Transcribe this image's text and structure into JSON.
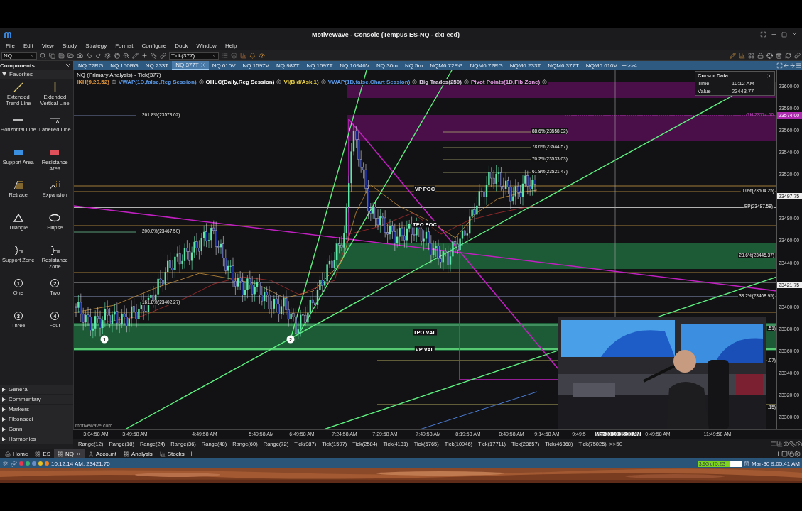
{
  "window": {
    "title": "MotiveWave - Console (Tempus ES-NQ - dxFeed)"
  },
  "menu": [
    "File",
    "Edit",
    "View",
    "Study",
    "Strategy",
    "Format",
    "Configure",
    "Dock",
    "Window",
    "Help"
  ],
  "toolbar": {
    "symbol": "NQ",
    "bar_size": "Tick(377)"
  },
  "components": {
    "title": "Components",
    "favorites": {
      "label": "Favorites",
      "expanded": true
    },
    "tools": [
      {
        "label": "Extended Trend Line",
        "kind": "trend"
      },
      {
        "label": "Extended Vertical Line",
        "kind": "vline"
      },
      {
        "label": "Horizontal Line",
        "kind": "hline"
      },
      {
        "label": "Labelled Line",
        "kind": "labelled"
      },
      {
        "label": "Support Area",
        "kind": "support"
      },
      {
        "label": "Resistance Area",
        "kind": "resistance"
      },
      {
        "label": "Retrace",
        "kind": "retrace"
      },
      {
        "label": "Expansion",
        "kind": "expansion"
      },
      {
        "label": "Triangle",
        "kind": "triangle"
      },
      {
        "label": "Ellipse",
        "kind": "ellipse"
      },
      {
        "label": "Support Zone",
        "kind": "zone"
      },
      {
        "label": "Resistance Zone",
        "kind": "zone"
      },
      {
        "label": "One",
        "kind": "number",
        "glyph": "1"
      },
      {
        "label": "Two",
        "kind": "number",
        "glyph": "2"
      },
      {
        "label": "Three",
        "kind": "number",
        "glyph": "3"
      },
      {
        "label": "Four",
        "kind": "number",
        "glyph": "4"
      }
    ],
    "categories": [
      {
        "label": "General",
        "expanded": false
      },
      {
        "label": "Commentary",
        "expanded": false
      },
      {
        "label": "Markers",
        "expanded": false
      },
      {
        "label": "Fibonacci",
        "expanded": false
      },
      {
        "label": "Gann",
        "expanded": false
      },
      {
        "label": "Harmonics",
        "expanded": false
      }
    ]
  },
  "chart_tabs": [
    {
      "label": "NQ 72RG",
      "selected": false
    },
    {
      "label": "NQ 150RG",
      "selected": false
    },
    {
      "label": "NQ 233T",
      "selected": false
    },
    {
      "label": "NQ 377T",
      "selected": true
    },
    {
      "label": "NQ 610V",
      "selected": false
    },
    {
      "label": "NQ 1597V",
      "selected": false
    },
    {
      "label": "NQ 987T",
      "selected": false
    },
    {
      "label": "NQ 1597T",
      "selected": false
    },
    {
      "label": "NQ 10946V",
      "selected": false
    },
    {
      "label": "NQ 30m",
      "selected": false
    },
    {
      "label": "NQ 5m",
      "selected": false
    },
    {
      "label": "NQM6 72RG",
      "selected": false
    },
    {
      "label": "NQM6 72RG",
      "selected": false
    },
    {
      "label": "NQM6 233T",
      "selected": false
    },
    {
      "label": "NQM6 377T",
      "selected": false
    },
    {
      "label": "NQM6 610V",
      "selected": false
    }
  ],
  "chart_tabs_overflow": ">>4",
  "chart": {
    "title": "NQ (Primary Analysis) - Tick(377)",
    "studies": [
      {
        "label": "IKH(9,26,52)",
        "color": "#e89a3c"
      },
      {
        "label": "VWAP(1D,false,Reg Session)",
        "color": "#5a9ae8"
      },
      {
        "label": "OHLC(Daily,Reg Session)",
        "color": "#ffffff"
      },
      {
        "label": "VI(Bid/Ask,1)",
        "color": "#e8d040"
      },
      {
        "label": "VWAP(1D,false,Chart Session)",
        "color": "#5a9ae8"
      },
      {
        "label": "Big Trades(250)",
        "color": "#e0d0e8"
      },
      {
        "label": "Pivot Points(1D,Fib Zone)",
        "color": "#e8a0e8"
      }
    ],
    "levels": [
      {
        "label": "261.8%(23573.02)"
      },
      {
        "label": "200.0%(23467.50)"
      },
      {
        "label": "161.8%(23402.27)"
      },
      {
        "label": "88.6%(23558.32)"
      },
      {
        "label": "78.6%(23544.57)"
      },
      {
        "label": "70.2%(23533.03)"
      },
      {
        "label": "61.8%(23521.47)"
      },
      {
        "label": "0.0%(23504.25)"
      },
      {
        "label": "BP(23487.58)"
      },
      {
        "label": "23.6%(23445.37)"
      },
      {
        "label": "38.2%(23408.95)"
      },
      {
        "label": ".51)"
      },
      {
        "label": ".07)"
      },
      {
        "label": ".15)"
      }
    ],
    "pivot_label": "GH:23574.00",
    "profile_labels": [
      "VP POC",
      "TPO POC",
      "TPO VAL",
      "VP VAL"
    ],
    "wave_markers": [
      "1",
      "2"
    ],
    "watermark_text": "motivewave.com",
    "cursor_data": {
      "title": "Cursor Data",
      "rows": [
        {
          "name": "Time",
          "value": "10:12 AM"
        },
        {
          "name": "Value",
          "value": "23443.77"
        }
      ]
    },
    "webcam": {
      "kind": "picture"
    },
    "price_axis": [
      {
        "label": "23600.00",
        "kind": "tick"
      },
      {
        "label": "23580.00",
        "kind": "tick"
      },
      {
        "label": "23560.00",
        "kind": "tick"
      },
      {
        "label": "23540.00",
        "kind": "tick"
      },
      {
        "label": "23520.00",
        "kind": "tick"
      },
      {
        "label": "23497.75",
        "kind": "current"
      },
      {
        "label": "23480.00",
        "kind": "tick"
      },
      {
        "label": "23460.00",
        "kind": "tick"
      },
      {
        "label": "23440.00",
        "kind": "tick"
      },
      {
        "label": "23421.75",
        "kind": "current"
      },
      {
        "label": "23400.00",
        "kind": "tick"
      },
      {
        "label": "23380.00",
        "kind": "tick"
      },
      {
        "label": "23360.00",
        "kind": "tick"
      },
      {
        "label": "23340.00",
        "kind": "tick"
      },
      {
        "label": "23320.00",
        "kind": "tick"
      },
      {
        "label": "23300.00",
        "kind": "tick"
      }
    ],
    "price_marker": "23574.00",
    "time_axis": [
      {
        "label": "3:04:58 AM",
        "kind": "tick"
      },
      {
        "label": "3:49:58 AM",
        "kind": "tick"
      },
      {
        "label": "4:49:58 AM",
        "kind": "tick"
      },
      {
        "label": "5:49:58 AM",
        "kind": "tick"
      },
      {
        "label": "6:49:58 AM",
        "kind": "tick"
      },
      {
        "label": "7:24:58 AM",
        "kind": "tick"
      },
      {
        "label": "7:29:58 AM",
        "kind": "tick"
      },
      {
        "label": "7:49:58 AM",
        "kind": "tick"
      },
      {
        "label": "8:19:58 AM",
        "kind": "tick"
      },
      {
        "label": "8:49:58 AM",
        "kind": "tick"
      },
      {
        "label": "9:14:58 AM",
        "kind": "tick"
      },
      {
        "label": "9:49:5",
        "kind": "tick"
      },
      {
        "label": "Mar-30 10:15:00 AM",
        "kind": "cursor"
      },
      {
        "label": "0:49:58 AM",
        "kind": "tick"
      },
      {
        "label": "11:49:58 AM",
        "kind": "tick"
      }
    ]
  },
  "bar_sizes": [
    "Range(12)",
    "Range(18)",
    "Range(24)",
    "Range(36)",
    "Range(48)",
    "Range(60)",
    "Range(72)",
    "Tick(987)",
    "Tick(1597)",
    "Tick(2584)",
    "Tick(4181)",
    "Tick(6765)",
    "Tick(10946)",
    "Tick(17711)",
    "Tick(28657)",
    "Tick(46368)",
    "Tick(75025)"
  ],
  "bar_sizes_overflow": ">>50",
  "workspace_tabs": [
    {
      "label": "Home",
      "kind": "home",
      "selected": false
    },
    {
      "label": "ES",
      "kind": "workspace",
      "selected": false
    },
    {
      "label": "NQ",
      "kind": "workspace",
      "selected": true
    },
    {
      "label": "Account",
      "kind": "account",
      "selected": false
    },
    {
      "label": "Analysis",
      "kind": "workspace",
      "selected": false
    },
    {
      "label": "Stocks",
      "kind": "chart",
      "selected": false
    }
  ],
  "status_bar": {
    "connections": [
      {
        "color": "#e8384f"
      },
      {
        "color": "#3cb371"
      },
      {
        "color": "#6a8fc8"
      },
      {
        "color": "#e8c020"
      },
      {
        "color": "#f08020"
      }
    ],
    "cursor": "10:12:14 AM, 23421.75",
    "memory": {
      "label": "3.9G of 5.2G",
      "level": 0.75
    },
    "clock": "Mar-30 9:05:41 AM"
  },
  "backdrop": {
    "kind": "picture"
  }
}
